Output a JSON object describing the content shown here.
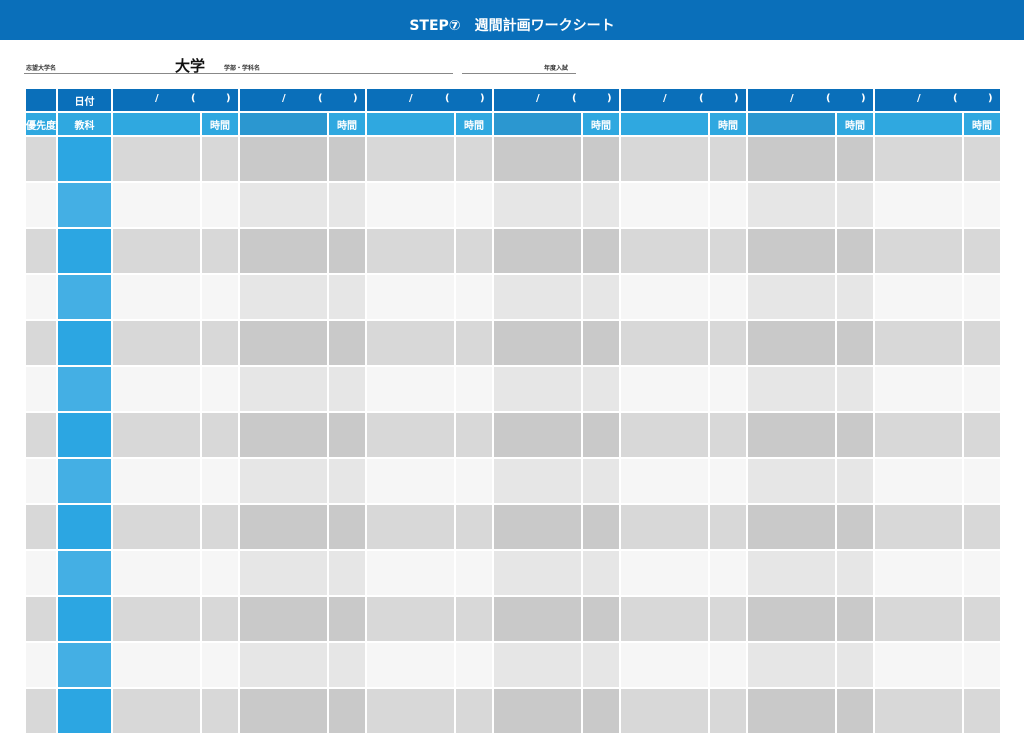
{
  "header": {
    "title": "STEP⑦　週間計画ワークシート"
  },
  "form": {
    "university_label": "志望大学名",
    "university_suffix": "大学",
    "faculty_label": "学部・学科名",
    "year_label": "年度入試"
  },
  "table": {
    "date_header": "日付",
    "priority_header": "優先度",
    "subject_header": "教科",
    "time_header": "時間",
    "date_slash": "/",
    "date_lparen": "(",
    "date_rparen": ")",
    "day_count": 7,
    "body_rows": 13
  },
  "colors": {
    "header_blue": "#0a6fba",
    "subheader_blue": "#2fa8e0",
    "subject_cell_a": "#2ca6e2",
    "subject_cell_b": "#44afe4",
    "gray_dark": "#c9c9c9",
    "gray_mid": "#d8d8d8",
    "gray_light": "#e6e6e6",
    "gray_pale": "#f6f6f6"
  }
}
